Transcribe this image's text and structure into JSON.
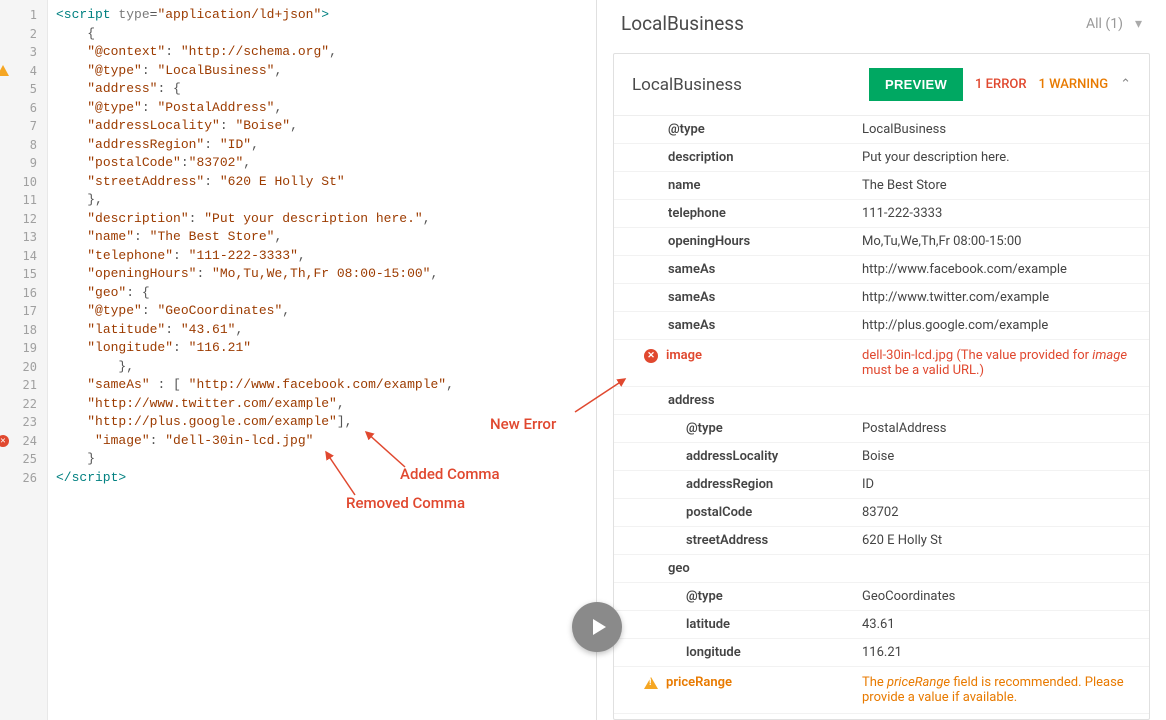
{
  "code": {
    "lines": [
      {
        "n": 1,
        "tokens": [
          {
            "t": "<script ",
            "c": "t-tag"
          },
          {
            "t": "type",
            "c": "t-attr"
          },
          {
            "t": "=",
            "c": "t-punc"
          },
          {
            "t": "\"application/ld+json\"",
            "c": "t-str"
          },
          {
            "t": ">",
            "c": "t-tag"
          }
        ]
      },
      {
        "n": 2,
        "tokens": [
          {
            "t": "    {",
            "c": "t-punc"
          }
        ]
      },
      {
        "n": 3,
        "tokens": [
          {
            "t": "    ",
            "c": ""
          },
          {
            "t": "\"@context\"",
            "c": "t-key"
          },
          {
            "t": ": ",
            "c": "t-punc"
          },
          {
            "t": "\"http://schema.org\"",
            "c": "t-str"
          },
          {
            "t": ",",
            "c": "t-punc"
          }
        ]
      },
      {
        "n": 4,
        "icon": "warn",
        "tokens": [
          {
            "t": "    ",
            "c": ""
          },
          {
            "t": "\"@type\"",
            "c": "t-key"
          },
          {
            "t": ": ",
            "c": "t-punc"
          },
          {
            "t": "\"LocalBusiness\"",
            "c": "t-str"
          },
          {
            "t": ",",
            "c": "t-punc"
          }
        ]
      },
      {
        "n": 5,
        "tokens": [
          {
            "t": "    ",
            "c": ""
          },
          {
            "t": "\"address\"",
            "c": "t-key"
          },
          {
            "t": ": {",
            "c": "t-punc"
          }
        ]
      },
      {
        "n": 6,
        "tokens": [
          {
            "t": "    ",
            "c": ""
          },
          {
            "t": "\"@type\"",
            "c": "t-key"
          },
          {
            "t": ": ",
            "c": "t-punc"
          },
          {
            "t": "\"PostalAddress\"",
            "c": "t-str"
          },
          {
            "t": ",",
            "c": "t-punc"
          }
        ]
      },
      {
        "n": 7,
        "tokens": [
          {
            "t": "    ",
            "c": ""
          },
          {
            "t": "\"addressLocality\"",
            "c": "t-key"
          },
          {
            "t": ": ",
            "c": "t-punc"
          },
          {
            "t": "\"Boise\"",
            "c": "t-str"
          },
          {
            "t": ",",
            "c": "t-punc"
          }
        ]
      },
      {
        "n": 8,
        "tokens": [
          {
            "t": "    ",
            "c": ""
          },
          {
            "t": "\"addressRegion\"",
            "c": "t-key"
          },
          {
            "t": ": ",
            "c": "t-punc"
          },
          {
            "t": "\"ID\"",
            "c": "t-str"
          },
          {
            "t": ",",
            "c": "t-punc"
          }
        ]
      },
      {
        "n": 9,
        "tokens": [
          {
            "t": "    ",
            "c": ""
          },
          {
            "t": "\"postalCode\"",
            "c": "t-key"
          },
          {
            "t": ":",
            "c": "t-punc"
          },
          {
            "t": "\"83702\"",
            "c": "t-str"
          },
          {
            "t": ",",
            "c": "t-punc"
          }
        ]
      },
      {
        "n": 10,
        "tokens": [
          {
            "t": "    ",
            "c": ""
          },
          {
            "t": "\"streetAddress\"",
            "c": "t-key"
          },
          {
            "t": ": ",
            "c": "t-punc"
          },
          {
            "t": "\"620 E Holly St\"",
            "c": "t-str"
          }
        ]
      },
      {
        "n": 11,
        "tokens": [
          {
            "t": "    },",
            "c": "t-punc"
          }
        ]
      },
      {
        "n": 12,
        "tokens": [
          {
            "t": "    ",
            "c": ""
          },
          {
            "t": "\"description\"",
            "c": "t-key"
          },
          {
            "t": ": ",
            "c": "t-punc"
          },
          {
            "t": "\"Put your description here.\"",
            "c": "t-str"
          },
          {
            "t": ",",
            "c": "t-punc"
          }
        ]
      },
      {
        "n": 13,
        "tokens": [
          {
            "t": "    ",
            "c": ""
          },
          {
            "t": "\"name\"",
            "c": "t-key"
          },
          {
            "t": ": ",
            "c": "t-punc"
          },
          {
            "t": "\"The Best Store\"",
            "c": "t-str"
          },
          {
            "t": ",",
            "c": "t-punc"
          }
        ]
      },
      {
        "n": 14,
        "tokens": [
          {
            "t": "    ",
            "c": ""
          },
          {
            "t": "\"telephone\"",
            "c": "t-key"
          },
          {
            "t": ": ",
            "c": "t-punc"
          },
          {
            "t": "\"111-222-3333\"",
            "c": "t-str"
          },
          {
            "t": ",",
            "c": "t-punc"
          }
        ]
      },
      {
        "n": 15,
        "tokens": [
          {
            "t": "    ",
            "c": ""
          },
          {
            "t": "\"openingHours\"",
            "c": "t-key"
          },
          {
            "t": ": ",
            "c": "t-punc"
          },
          {
            "t": "\"Mo,Tu,We,Th,Fr 08:00-15:00\"",
            "c": "t-str"
          },
          {
            "t": ",",
            "c": "t-punc"
          }
        ]
      },
      {
        "n": 16,
        "tokens": [
          {
            "t": "    ",
            "c": ""
          },
          {
            "t": "\"geo\"",
            "c": "t-key"
          },
          {
            "t": ": {",
            "c": "t-punc"
          }
        ]
      },
      {
        "n": 17,
        "tokens": [
          {
            "t": "    ",
            "c": ""
          },
          {
            "t": "\"@type\"",
            "c": "t-key"
          },
          {
            "t": ": ",
            "c": "t-punc"
          },
          {
            "t": "\"GeoCoordinates\"",
            "c": "t-str"
          },
          {
            "t": ",",
            "c": "t-punc"
          }
        ]
      },
      {
        "n": 18,
        "tokens": [
          {
            "t": "    ",
            "c": ""
          },
          {
            "t": "\"latitude\"",
            "c": "t-key"
          },
          {
            "t": ": ",
            "c": "t-punc"
          },
          {
            "t": "\"43.61\"",
            "c": "t-str"
          },
          {
            "t": ",",
            "c": "t-punc"
          }
        ]
      },
      {
        "n": 19,
        "tokens": [
          {
            "t": "    ",
            "c": ""
          },
          {
            "t": "\"longitude\"",
            "c": "t-key"
          },
          {
            "t": ": ",
            "c": "t-punc"
          },
          {
            "t": "\"116.21\"",
            "c": "t-str"
          }
        ]
      },
      {
        "n": 20,
        "tokens": [
          {
            "t": "        },",
            "c": "t-punc"
          }
        ]
      },
      {
        "n": 21,
        "tokens": [
          {
            "t": "    ",
            "c": ""
          },
          {
            "t": "\"sameAs\"",
            "c": "t-key"
          },
          {
            "t": " : [ ",
            "c": "t-punc"
          },
          {
            "t": "\"http://www.facebook.com/example\"",
            "c": "t-str"
          },
          {
            "t": ",",
            "c": "t-punc"
          }
        ]
      },
      {
        "n": 22,
        "tokens": [
          {
            "t": "    ",
            "c": ""
          },
          {
            "t": "\"http://www.twitter.com/example\"",
            "c": "t-str"
          },
          {
            "t": ",",
            "c": "t-punc"
          }
        ]
      },
      {
        "n": 23,
        "tokens": [
          {
            "t": "    ",
            "c": ""
          },
          {
            "t": "\"http://plus.google.com/example\"",
            "c": "t-str"
          },
          {
            "t": "],",
            "c": "t-punc"
          }
        ]
      },
      {
        "n": 24,
        "icon": "err",
        "tokens": [
          {
            "t": "     ",
            "c": ""
          },
          {
            "t": "\"image\"",
            "c": "t-key"
          },
          {
            "t": ": ",
            "c": "t-punc"
          },
          {
            "t": "\"dell-30in-lcd.jpg\"",
            "c": "t-str"
          }
        ]
      },
      {
        "n": 25,
        "tokens": [
          {
            "t": "    }",
            "c": "t-punc"
          }
        ]
      },
      {
        "n": 26,
        "tokens": [
          {
            "t": "</script>",
            "c": "t-tag"
          }
        ]
      }
    ]
  },
  "annotations": {
    "newError": "New Error",
    "addedComma": "Added Comma",
    "removedComma": "Removed Comma"
  },
  "header": {
    "title": "LocalBusiness",
    "filter": "All (1)"
  },
  "card": {
    "title": "LocalBusiness",
    "preview": "PREVIEW",
    "errorBadge": "1 ERROR",
    "warnBadge": "1 WARNING",
    "rows": [
      {
        "indent": 1,
        "key": "@type",
        "val": "LocalBusiness"
      },
      {
        "indent": 1,
        "key": "description",
        "val": "Put your description here."
      },
      {
        "indent": 1,
        "key": "name",
        "val": "The Best Store"
      },
      {
        "indent": 1,
        "key": "telephone",
        "val": "111-222-3333"
      },
      {
        "indent": 1,
        "key": "openingHours",
        "val": "Mo,Tu,We,Th,Fr 08:00-15:00"
      },
      {
        "indent": 1,
        "key": "sameAs",
        "val": "http://www.facebook.com/example"
      },
      {
        "indent": 1,
        "key": "sameAs",
        "val": "http://www.twitter.com/example"
      },
      {
        "indent": 1,
        "key": "sameAs",
        "val": "http://plus.google.com/example"
      },
      {
        "indent": 1,
        "key": "image",
        "type": "err",
        "valHtml": "dell-30in-lcd.jpg (The value provided for <span class=\"italic\">image</span> must be a valid URL.)"
      },
      {
        "indent": 1,
        "key": "address",
        "val": ""
      },
      {
        "indent": 2,
        "key": "@type",
        "val": "PostalAddress"
      },
      {
        "indent": 2,
        "key": "addressLocality",
        "val": "Boise"
      },
      {
        "indent": 2,
        "key": "addressRegion",
        "val": "ID"
      },
      {
        "indent": 2,
        "key": "postalCode",
        "val": "83702"
      },
      {
        "indent": 2,
        "key": "streetAddress",
        "val": "620 E Holly St"
      },
      {
        "indent": 1,
        "key": "geo",
        "val": ""
      },
      {
        "indent": 2,
        "key": "@type",
        "val": "GeoCoordinates"
      },
      {
        "indent": 2,
        "key": "latitude",
        "val": "43.61"
      },
      {
        "indent": 2,
        "key": "longitude",
        "val": "116.21"
      },
      {
        "indent": 1,
        "key": "priceRange",
        "type": "warn",
        "valHtml": "The <span class=\"italic\">priceRange</span> field is recommended. Please provide a value if available."
      }
    ]
  }
}
